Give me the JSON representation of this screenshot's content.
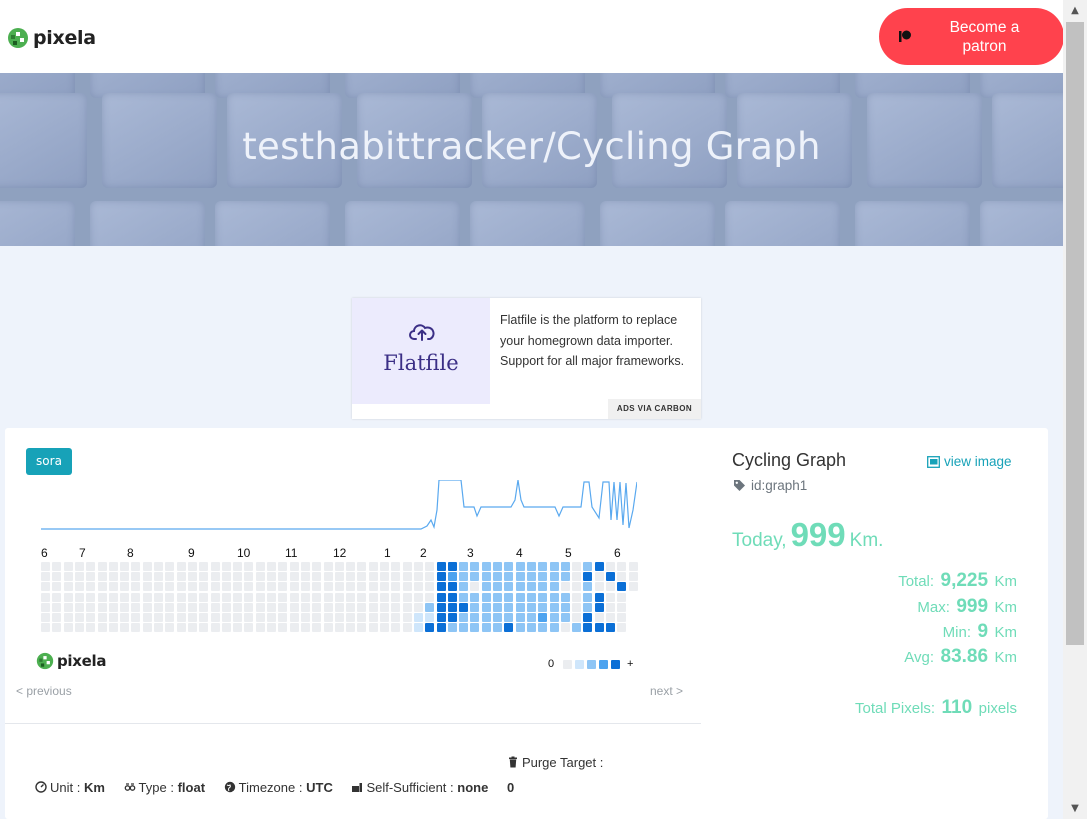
{
  "header": {
    "logo_text": "pixela",
    "patron_button": "Become a patron"
  },
  "hero": {
    "title": "testhabittracker/Cycling Graph"
  },
  "ad": {
    "brand": "Flatfile",
    "text": "Flatfile is the platform to replace your homegrown data importer. Support for all major frameworks.",
    "via": "ADS VIA CARBON"
  },
  "card": {
    "user_badge": "sora",
    "logo_text": "pixela",
    "previous": "< previous",
    "next": "next >",
    "months": [
      "6",
      "7",
      "8",
      "9",
      "10",
      "11",
      "12",
      "1",
      "2",
      "3",
      "4",
      "5",
      "6"
    ],
    "legend": {
      "low": "0",
      "high": "+"
    },
    "properties": {
      "unit_label": "Unit",
      "unit_value": "Km",
      "type_label": "Type",
      "type_value": "float",
      "timezone_label": "Timezone",
      "timezone_value": "UTC",
      "self_sufficient_label": "Self-Sufficient",
      "self_sufficient_value": "none",
      "purge_label": "Purge Target",
      "purge_value": "0"
    }
  },
  "stats": {
    "graph_name": "Cycling Graph",
    "view_image": "view image",
    "graph_id": "id:graph1",
    "today_label": "Today,",
    "today_value": "999",
    "today_unit": "Km.",
    "total_label": "Total:",
    "total_value": "9,225",
    "max_label": "Max:",
    "max_value": "999",
    "min_label": "Min:",
    "min_value": "9",
    "avg_label": "Avg:",
    "avg_value": "83.86",
    "unit": "Km",
    "pixels_label": "Total Pixels:",
    "pixels_value": "110",
    "pixels_unit": "pixels"
  },
  "colors": {
    "accent_green": "#6fdcb8",
    "patreon_red": "#ff424d",
    "info_teal": "#17a2b8",
    "level_0": "#ebedf0",
    "level_1": "#cfe6fb",
    "level_2": "#8ec5f5",
    "level_3": "#4da3ef",
    "level_4": "#0b6fd6"
  }
}
